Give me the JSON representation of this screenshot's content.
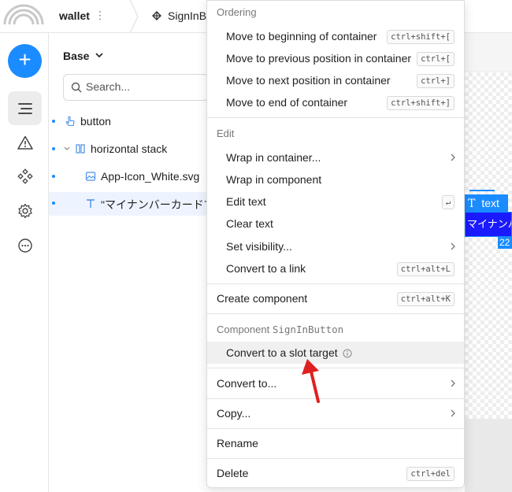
{
  "topbar": {
    "project_name": "wallet",
    "project_menu": "⋮",
    "tab_label": "SignInB"
  },
  "rail": {
    "add_label": "+",
    "items": [
      "layers-icon",
      "warning-icon",
      "components-icon",
      "settings-icon",
      "more-icon"
    ]
  },
  "panel": {
    "base_label": "Base",
    "search_placeholder": "Search...",
    "layers": [
      {
        "label": "button",
        "icon": "pointer-icon"
      },
      {
        "label": "horizontal stack",
        "icon": "hstack-icon"
      },
      {
        "label": "App-Icon_White.svg",
        "icon": "image-icon"
      },
      {
        "label": "\"マイナンバーカードで",
        "icon": "text-icon"
      }
    ]
  },
  "canvas": {
    "selection_tag": "text",
    "selection_tag_icon": "T",
    "selection_text": "マイナンバー",
    "dimension_badge": "22"
  },
  "menu": {
    "ordering_header": "Ordering",
    "move_beginning": "Move to beginning of container",
    "move_beginning_kbd": "ctrl+shift+[",
    "move_previous": "Move to previous position in container",
    "move_previous_kbd": "ctrl+[",
    "move_next": "Move to next position in container",
    "move_next_kbd": "ctrl+]",
    "move_end": "Move to end of container",
    "move_end_kbd": "ctrl+shift+]",
    "edit_header": "Edit",
    "wrap_container": "Wrap in container...",
    "wrap_component": "Wrap in component",
    "edit_text": "Edit text",
    "edit_text_kbd": "↵",
    "clear_text": "Clear text",
    "set_visibility": "Set visibility...",
    "convert_link": "Convert to a link",
    "convert_link_kbd": "ctrl+alt+L",
    "create_component": "Create component",
    "create_component_kbd": "ctrl+alt+K",
    "component_header_prefix": "Component",
    "component_header_name": "SignInButton",
    "convert_slot": "Convert to a slot target",
    "convert_to": "Convert to...",
    "copy": "Copy...",
    "rename": "Rename",
    "delete": "Delete",
    "delete_kbd": "ctrl+del"
  },
  "colors": {
    "accent": "#1a8cff",
    "annotation_arrow": "#e02020"
  }
}
